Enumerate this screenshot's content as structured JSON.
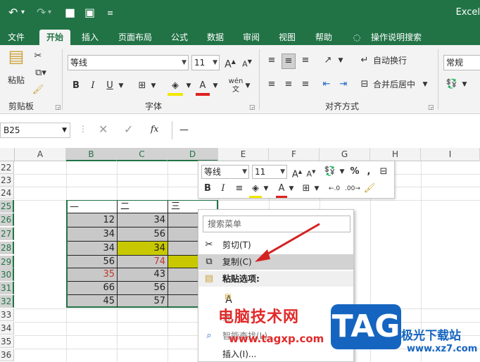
{
  "titlebar": {
    "app_name": "Excel"
  },
  "tabs": [
    {
      "label": "文件"
    },
    {
      "label": "开始"
    },
    {
      "label": "插入"
    },
    {
      "label": "页面布局"
    },
    {
      "label": "公式"
    },
    {
      "label": "数据"
    },
    {
      "label": "审阅"
    },
    {
      "label": "视图"
    },
    {
      "label": "帮助"
    },
    {
      "label": "操作说明搜索"
    }
  ],
  "ribbon": {
    "clipboard": {
      "paste_label": "粘贴",
      "group_label": "剪贴板"
    },
    "font": {
      "font_name": "等线",
      "font_size": "11",
      "group_label": "字体",
      "bold": "B",
      "italic": "I",
      "underline": "U",
      "grow": "A",
      "shrink": "A"
    },
    "alignment": {
      "wrap_text": "自动换行",
      "merge_center": "合并后居中",
      "group_label": "对齐方式"
    },
    "number": {
      "format": "常规"
    }
  },
  "formula_bar": {
    "name_box": "B25",
    "fx": "fx",
    "content": "—"
  },
  "columns": [
    "A",
    "B",
    "C",
    "D",
    "E",
    "F",
    "G",
    "H",
    "I"
  ],
  "rows": [
    "22",
    "23",
    "24",
    "25",
    "26",
    "27",
    "28",
    "29",
    "30",
    "31",
    "32",
    "33",
    "34",
    "35",
    "36"
  ],
  "cells": {
    "header": [
      "—",
      "二",
      "三"
    ],
    "b": [
      "12",
      "34",
      "34",
      "56",
      "35",
      "66",
      "45"
    ],
    "c": [
      "34",
      "56",
      "34",
      "74",
      "43",
      "56",
      "57"
    ]
  },
  "mini_toolbar": {
    "font_name": "等线",
    "font_size": "11",
    "percent": "%",
    "comma": ","
  },
  "context_menu": {
    "search_placeholder": "搜索菜单",
    "cut": "剪切(T)",
    "copy": "复制(C)",
    "paste_options": "粘贴选项:",
    "paste_a": "A",
    "partial_1": "选",
    "smart_lookup": "智能查找(L)",
    "insert": "插入(I)..."
  },
  "watermark": {
    "text": "电脑技术网",
    "url": "www.tagxp.com",
    "tag": "TAG",
    "site": "极光下载站",
    "url2": "www.xz7.com"
  },
  "colors": {
    "excel_green": "#217346",
    "selection_gray": "#c8c8c8",
    "highlight_yellow": "#c8c800",
    "red_text": "#c0392b"
  }
}
